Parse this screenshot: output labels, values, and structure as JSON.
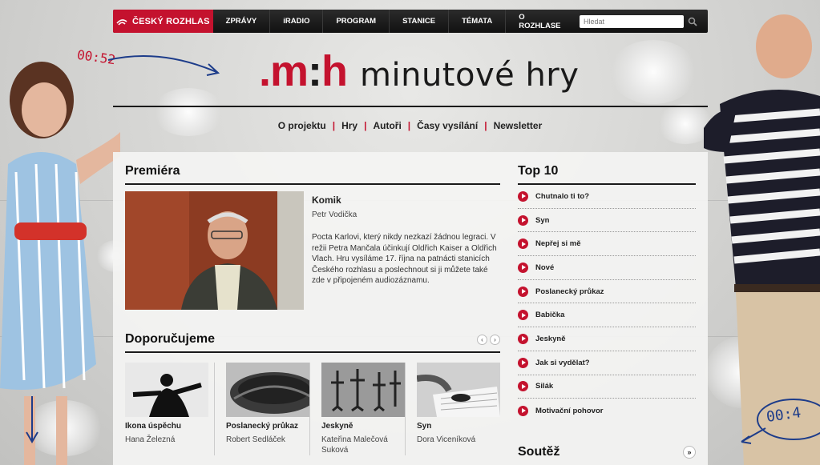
{
  "brand": {
    "name": "ČESKÝ ROZHLAS"
  },
  "topnav": [
    "ZPRÁVY",
    "iRADIO",
    "PROGRAM",
    "STANICE",
    "TÉMATA",
    "O ROZHLASE"
  ],
  "search": {
    "placeholder": "Hledat"
  },
  "logo": {
    "mark_red1": ".m",
    "mark_dark": ":",
    "mark_red2": "h",
    "text": "minutové hry"
  },
  "subnav": [
    "O projektu",
    "Hry",
    "Autoři",
    "Časy vysílání",
    "Newsletter"
  ],
  "doodles": {
    "left_time": "00:52",
    "right_time": "00:4"
  },
  "premiera": {
    "title": "Premiéra",
    "item": {
      "title": "Komik",
      "author": "Petr Vodička",
      "description": "Pocta Karlovi, který nikdy nezkazí žádnou legraci. V režii Petra Mančala účinkují Oldřich Kaiser a Oldřich Vlach. Hru vysíláme 17. října na patnácti stanicích Českého rozhlasu a poslechnout si ji můžete také zde v připojeném audiozáznamu."
    }
  },
  "doporucujeme": {
    "title": "Doporučujeme",
    "prev": "‹",
    "next": "›",
    "items": [
      {
        "title": "Ikona úspěchu",
        "author": "Hana Železná"
      },
      {
        "title": "Poslanecký průkaz",
        "author": "Robert Sedláček"
      },
      {
        "title": "Jeskyně",
        "author": "Kateřina Malečová Suková"
      },
      {
        "title": "Syn",
        "author": "Dora Viceníková"
      }
    ]
  },
  "top10": {
    "title": "Top 10",
    "items": [
      "Chutnalo ti to?",
      "Syn",
      "Nepřej si mě",
      "Nové",
      "Poslanecký průkaz",
      "Babička",
      "Jeskyně",
      "Jak si vydělat?",
      "Silák",
      "Motivační pohovor"
    ]
  },
  "soutez": {
    "title": "Soutěž",
    "more": "»"
  },
  "colors": {
    "accent": "#c4122e",
    "nav_bg": "#1a1a1a",
    "panel": "#f4f4f3"
  }
}
